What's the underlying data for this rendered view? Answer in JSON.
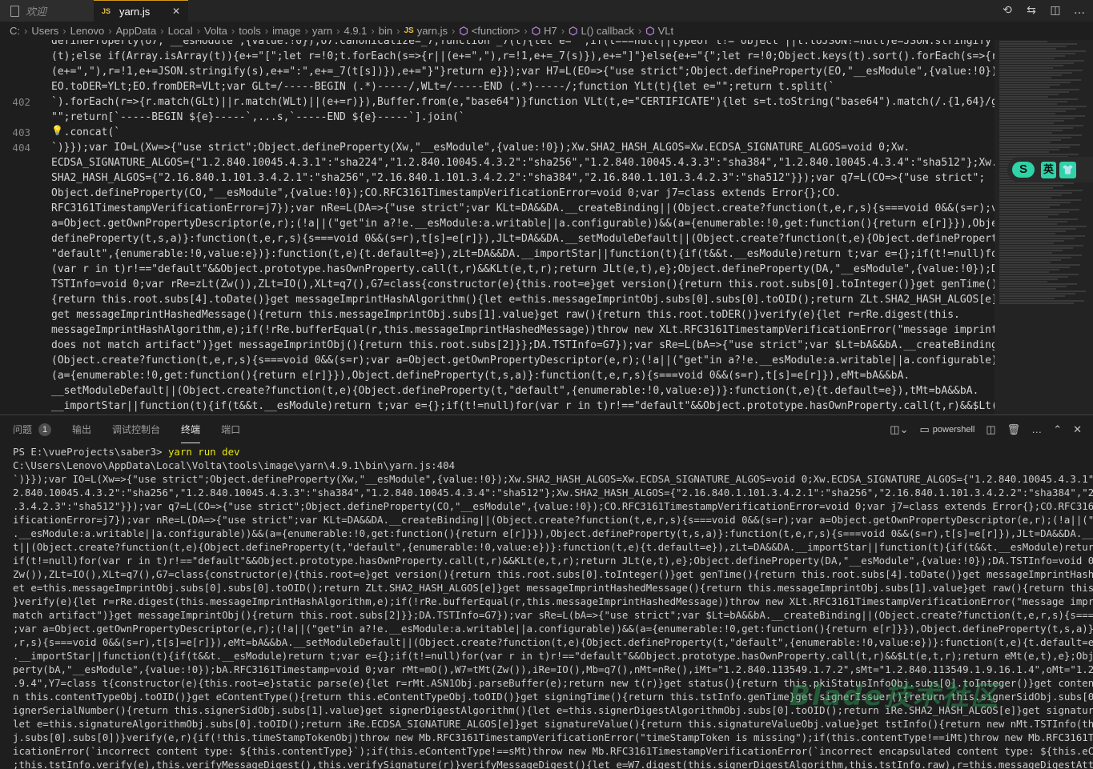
{
  "tabs": [
    {
      "label": "欢迎",
      "icon": "document-icon",
      "active": false
    },
    {
      "label": "yarn.js",
      "icon": "js-file-icon",
      "active": true
    }
  ],
  "breadcrumb": [
    "C:",
    "Users",
    "Lenovo",
    "AppData",
    "Local",
    "Volta",
    "tools",
    "image",
    "yarn",
    "4.9.1",
    "bin",
    "yarn.js",
    "<function>",
    "H7",
    "L() callback",
    "VLt"
  ],
  "editor": {
    "line_numbers": [
      {
        "n": "402",
        "row": 4
      },
      {
        "n": "403",
        "row": 6
      },
      {
        "n": "404",
        "row": 7
      }
    ],
    "lines": [
      "defineProperty(o7,\"__esModule\",{value:!0});o7.canonicalize=_7;function _7(t){let e=\"\";if(t===null||typeof t!=\"object\"||t.toJSON!=null)e=JSON.stringify",
      "(t);else if(Array.isArray(t)){e+=\"[\";let r=!0;t.forEach(s=>{r||(e+=\",\"),r=!1,e+=_7(s)}),e+=\"]\"}else{e+=\"{\";let r=!0;Object.keys(t).sort().forEach(s=>{r||",
      "(e+=\",\"),r=!1,e+=JSON.stringify(s),e+=\":\",e+=_7(t[s])}),e+=\"}\"}return e}});var H7=L(EO=>{\"use strict\";Object.defineProperty(EO,\"__esModule\",{value:!0});",
      "EO.toDER=YLt;EO.fromDER=VLt;var GLt=/-----BEGIN (.*)-----/,WLt=/-----END (.*)-----/;function YLt(t){let e=\"\";return t.split(`",
      "`).forEach(r=>{r.match(GLt)||r.match(WLt)||(e+=r)}),Buffer.from(e,\"base64\")}function VLt(t,e=\"CERTIFICATE\"){let s=t.toString(\"base64\").match(/.{1,64}/g)||",
      "\"\";return[`-----BEGIN ${e}-----`,...s,`-----END ${e}-----`].join(`",
      "  .concat(`",
      "`)}});var IO=L(Xw=>{\"use strict\";Object.defineProperty(Xw,\"__esModule\",{value:!0});Xw.SHA2_HASH_ALGOS=Xw.ECDSA_SIGNATURE_ALGOS=void 0;Xw.",
      "ECDSA_SIGNATURE_ALGOS={\"1.2.840.10045.4.3.1\":\"sha224\",\"1.2.840.10045.4.3.2\":\"sha256\",\"1.2.840.10045.4.3.3\":\"sha384\",\"1.2.840.10045.4.3.4\":\"sha512\"};Xw.",
      "SHA2_HASH_ALGOS={\"2.16.840.1.101.3.4.2.1\":\"sha256\",\"2.16.840.1.101.3.4.2.2\":\"sha384\",\"2.16.840.1.101.3.4.2.3\":\"sha512\"}});var q7=L(CO=>{\"use strict\";",
      "Object.defineProperty(CO,\"__esModule\",{value:!0});CO.RFC3161TimestampVerificationError=void 0;var j7=class extends Error{};CO.",
      "RFC3161TimestampVerificationError=j7});var nRe=L(DA=>{\"use strict\";var KLt=DA&&DA.__createBinding||(Object.create?function(t,e,r,s){s===void 0&&(s=r);var",
      "a=Object.getOwnPropertyDescriptor(e,r);(!a||(\"get\"in a?!e.__esModule:a.writable||a.configurable))&&(a={enumerable:!0,get:function(){return e[r]}}),Object.",
      "defineProperty(t,s,a)}:function(t,e,r,s){s===void 0&&(s=r),t[s]=e[r]}),JLt=DA&&DA.__setModuleDefault||(Object.create?function(t,e){Object.defineProperty(t,",
      "\"default\",{enumerable:!0,value:e})}:function(t,e){t.default=e}),zLt=DA&&DA.__importStar||function(t){if(t&&t.__esModule)return t;var e={};if(t!=null)for",
      "(var r in t)r!==\"default\"&&Object.prototype.hasOwnProperty.call(t,r)&&KLt(e,t,r);return JLt(e,t),e};Object.defineProperty(DA,\"__esModule\",{value:!0});DA.",
      "TSTInfo=void 0;var rRe=zLt(Zw()),ZLt=IO(),XLt=q7(),G7=class{constructor(e){this.root=e}get version(){return this.root.subs[0].toInteger()}get genTime()",
      "{return this.root.subs[4].toDate()}get messageImprintHashAlgorithm(){let e=this.messageImprintObj.subs[0].subs[0].toOID();return ZLt.SHA2_HASH_ALGOS[e]}",
      "get messageImprintHashedMessage(){return this.messageImprintObj.subs[1].value}get raw(){return this.root.toDER()}verify(e){let r=rRe.digest(this.",
      "messageImprintHashAlgorithm,e);if(!rRe.bufferEqual(r,this.messageImprintHashedMessage))throw new XLt.RFC3161TimestampVerificationError(\"message imprint",
      "does not match artifact\")}get messageImprintObj(){return this.root.subs[2]}};DA.TSTInfo=G7});var sRe=L(bA=>{\"use strict\";var $Lt=bA&&bA.__createBinding||",
      "(Object.create?function(t,e,r,s){s===void 0&&(s=r);var a=Object.getOwnPropertyDescriptor(e,r);(!a||(\"get\"in a?!e.__esModule:a.writable||a.configurable))&&",
      "(a={enumerable:!0,get:function(){return e[r]}}),Object.defineProperty(t,s,a)}:function(t,e,r,s){s===void 0&&(s=r),t[s]=e[r]}),eMt=bA&&bA.",
      "__setModuleDefault||(Object.create?function(t,e){Object.defineProperty(t,\"default\",{enumerable:!0,value:e})}:function(t,e){t.default=e}),tMt=bA&&bA.",
      "__importStar||function(t){if(t&&t.__esModule)return t;var e={};if(t!=null)for(var r in t)r!==\"default\"&&Object.prototype.hasOwnProperty.call(t,r)&&$Lt(e,t,"
    ]
  },
  "ime": {
    "logo": "S",
    "mode": "英"
  },
  "panel": {
    "tabs": [
      {
        "label": "问题",
        "badge": "1",
        "active": false
      },
      {
        "label": "输出",
        "active": false
      },
      {
        "label": "调试控制台",
        "active": false
      },
      {
        "label": "终端",
        "active": true
      },
      {
        "label": "端口",
        "active": false
      }
    ],
    "terminal_name": "powershell"
  },
  "terminal": {
    "prompt": "PS E:\\vueProjects\\saber3> ",
    "command": "yarn run dev",
    "lines": [
      "C:\\Users\\Lenovo\\AppData\\Local\\Volta\\tools\\image\\yarn\\4.9.1\\bin\\yarn.js:404",
      "`)}});var IO=L(Xw=>{\"use strict\";Object.defineProperty(Xw,\"__esModule\",{value:!0});Xw.SHA2_HASH_ALGOS=Xw.ECDSA_SIGNATURE_ALGOS=void 0;Xw.ECDSA_SIGNATURE_ALGOS={\"1.2.840.10045.4.3.1\":\"sha224\",\"1",
      "2.840.10045.4.3.2\":\"sha256\",\"1.2.840.10045.4.3.3\":\"sha384\",\"1.2.840.10045.4.3.4\":\"sha512\"};Xw.SHA2_HASH_ALGOS={\"2.16.840.1.101.3.4.2.1\":\"sha256\",\"2.16.840.1.101.3.4.2.2\":\"sha384\",\"2.16.840.1.10",
      ".3.4.2.3\":\"sha512\"}});var q7=L(CO=>{\"use strict\";Object.defineProperty(CO,\"__esModule\",{value:!0});CO.RFC3161TimestampVerificationError=void 0;var j7=class extends Error{};CO.RFC3161TimestampVe",
      "ificationError=j7});var nRe=L(DA=>{\"use strict\";var KLt=DA&&DA.__createBinding||(Object.create?function(t,e,r,s){s===void 0&&(s=r);var a=Object.getOwnPropertyDescriptor(e,r);(!a||(\"get\"in a?!e",
      ".__esModule:a.writable||a.configurable))&&(a={enumerable:!0,get:function(){return e[r]}}),Object.defineProperty(t,s,a)}:function(t,e,r,s){s===void 0&&(s=r),t[s]=e[r]}),JLt=DA&&DA.__setModuleDefau",
      "t||(Object.create?function(t,e){Object.defineProperty(t,\"default\",{enumerable:!0,value:e})}:function(t,e){t.default=e}),zLt=DA&&DA.__importStar||function(t){if(t&&t.__esModule)return t;var e={",
      "if(t!=null)for(var r in t)r!==\"default\"&&Object.prototype.hasOwnProperty.call(t,r)&&KLt(e,t,r);return JLt(e,t),e};Object.defineProperty(DA,\"__esModule\",{value:!0});DA.TSTInfo=void 0;var rRe=zLt",
      "Zw()),ZLt=IO(),XLt=q7(),G7=class{constructor(e){this.root=e}get version(){return this.root.subs[0].toInteger()}get genTime(){return this.root.subs[4].toDate()}get messageImprintHashAlgorithm(){l",
      "et e=this.messageImprintObj.subs[0].subs[0].toOID();return ZLt.SHA2_HASH_ALGOS[e]}get messageImprintHashedMessage(){return this.messageImprintObj.subs[1].value}get raw(){return this.root.toDER(",
      "}verify(e){let r=rRe.digest(this.messageImprintHashAlgorithm,e);if(!rRe.bufferEqual(r,this.messageImprintHashedMessage))throw new XLt.RFC3161TimestampVerificationError(\"message imprint does not",
      "match artifact\")}get messageImprintObj(){return this.root.subs[2]}};DA.TSTInfo=G7});var sRe=L(bA=>{\"use strict\";var $Lt=bA&&bA.__createBinding||(Object.create?function(t,e,r,s){s===void 0&&(s=r)",
      ";var a=Object.getOwnPropertyDescriptor(e,r);(!a||(\"get\"in a?!e.__esModule:a.writable||a.configurable))&&(a={enumerable:!0,get:function(){return e[r]}}),Object.defineProperty(t,s,a)}:function(t",
      ",r,s){s===void 0&&(s=r),t[s]=e[r]}),eMt=bA&&bA.__setModuleDefault||(Object.create?function(t,e){Object.defineProperty(t,\"default\",{enumerable:!0,value:e})}:function(t,e){t.default=e}),tMt=bA&&bA",
      ".__importStar||function(t){if(t&&t.__esModule)return t;var e={};if(t!=null)for(var r in t)r!==\"default\"&&Object.prototype.hasOwnProperty.call(t,r)&&$Lt(e,t,r);return eMt(e,t),e};Object.definePr",
      "perty(bA,\"__esModule\",{value:!0});bA.RFC3161Timestamp=void 0;var rMt=mO(),W7=tMt(Zw()),iRe=IO(),Mb=q7(),nMt=nRe(),iMt=\"1.2.840.113549.1.7.2\",sMt=\"1.2.840.113549.1.9.16.1.4\",oMt=\"1.2.840.113549",
      ".9.4\",Y7=class t{constructor(e){this.root=e}static parse(e){let r=rMt.ASN1Obj.parseBuffer(e);return new t(r)}get status(){return this.pkiStatusInfoObj.subs[0].toInteger()}get contentType(){retu",
      "n this.contentTypeObj.toOID()}get eContentType(){return this.eContentTypeObj.toOID()}get signingTime(){return this.tstInfo.genTime}get signerIssuer(){return this.signerSidObj.subs[0].value}get",
      "ignerSerialNumber(){return this.signerSidObj.subs[1].value}get signerDigestAlgorithm(){let e=this.signerDigestAlgorithmObj.subs[0].toOID();return iRe.SHA2_HASH_ALGOS[e]}get signatureAlgorithm(){",
      "let e=this.signatureAlgorithmObj.subs[0].toOID();return iRe.ECDSA_SIGNATURE_ALGOS[e]}get signatureValue(){return this.signatureValueObj.value}get tstInfo(){return new nMt.TSTInfo(this.eContentO",
      "j.subs[0].subs[0])}verify(e,r){if(!this.timeStampTokenObj)throw new Mb.RFC3161TimestampVerificationError(\"timeStampToken is missing\");if(this.contentType!==iMt)throw new Mb.RFC3161TimestampVeri",
      "icationError(`incorrect content type: ${this.contentType}`);if(this.eContentType!==sMt)throw new Mb.RFC3161TimestampVerificationError(`incorrect encapsulated content type: ${this.eContentType}",
      ";this.tstInfo.verify(e),this.verifyMessageDigest(),this.verifySignature(r)}verifyMessageDigest(){let e=W7.digest(this.signerDigestAlgorithm,this.tstInfo.raw),r=this.messageDigestAttributeObj.v"
    ]
  },
  "watermark": "Blade技术社区"
}
